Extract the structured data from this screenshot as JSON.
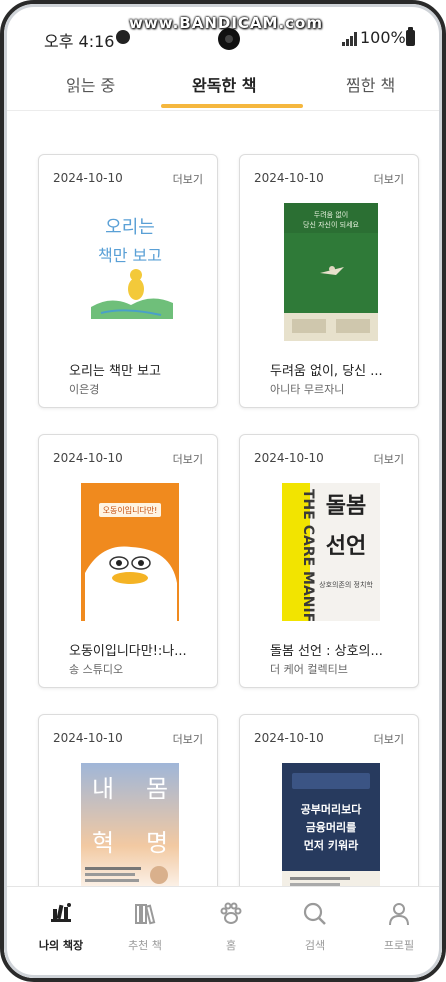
{
  "status_bar": {
    "time": "오후 4:16",
    "battery": "100%"
  },
  "watermark": "www.BANDICAM.com",
  "tabs": [
    {
      "label": "읽는 중",
      "active": false
    },
    {
      "label": "완독한 책",
      "active": true
    },
    {
      "label": "찜한 책",
      "active": false
    }
  ],
  "more_label": "더보기",
  "books": [
    {
      "date": "2024-10-10",
      "title": "오리는 책만 보고",
      "author": "이은경",
      "cover": "duck-book-cover"
    },
    {
      "date": "2024-10-10",
      "title": "두려움 없이, 당신 ...",
      "author": "아니타 무르자니",
      "cover": "green-cover"
    },
    {
      "date": "2024-10-10",
      "title": "오동이입니다만!:나...",
      "author": "송 스튜디오",
      "cover": "duck-cartoon-cover"
    },
    {
      "date": "2024-10-10",
      "title": "돌봄 선언 : 상호의...",
      "author": "더 케어 컬렉티브",
      "cover": "care-manifesto-cover"
    },
    {
      "date": "2024-10-10",
      "title": "",
      "author": "",
      "cover": "life-cover"
    },
    {
      "date": "2024-10-10",
      "title": "",
      "author": "",
      "cover": "finance-cover"
    }
  ],
  "covers": {
    "book1": {
      "line1": "오리는",
      "line2": "책만 보고"
    },
    "book2": {
      "line1": "두려움 없이",
      "line2": "당신 자신이 되세요"
    },
    "book3": {
      "line1": "오동이입니다만!"
    },
    "book4": {
      "vertical": "THE CARE MANIFESTO",
      "title": "돌봄선언",
      "sub": "상호의존의 정치학"
    },
    "book5": {
      "a": "내",
      "b": "몸",
      "c": "혁",
      "d": "명"
    },
    "book6": {
      "line1": "공부머리보다",
      "line2": "금융머리를",
      "line3": "먼저 키워라"
    }
  },
  "bottom_nav": [
    {
      "label": "나의 책장",
      "icon": "bookshelf-icon",
      "active": true
    },
    {
      "label": "추천 책",
      "icon": "books-icon",
      "active": false
    },
    {
      "label": "홈",
      "icon": "paw-icon",
      "active": false
    },
    {
      "label": "검색",
      "icon": "search-icon",
      "active": false
    },
    {
      "label": "프로필",
      "icon": "profile-icon",
      "active": false
    }
  ],
  "colors": {
    "accent": "#f5b73e",
    "active_text": "#222222",
    "inactive_text": "#9a9a9a"
  }
}
